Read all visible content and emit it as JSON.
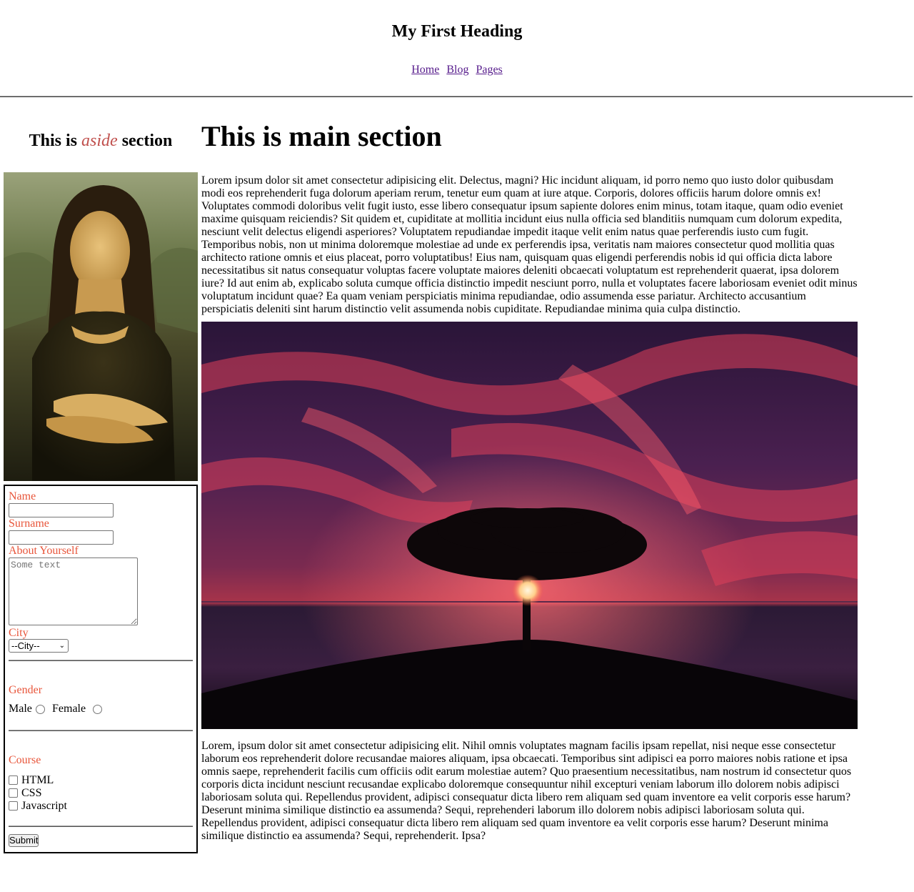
{
  "header": {
    "title": "My First Heading",
    "nav": [
      "Home",
      "Blog",
      "Pages"
    ]
  },
  "aside": {
    "title_before": "This is",
    "title_emphasis": "aside",
    "title_after": "section",
    "image": "Mona Lisa painting",
    "form": {
      "name_label": "Name",
      "name_value": "",
      "surname_label": "Surname",
      "surname_value": "",
      "about_label": "About Yourself",
      "about_placeholder": "Some text",
      "city_label": "City",
      "city_selected": "--City--",
      "gender_label": "Gender",
      "gender_options": [
        "Male",
        "Female"
      ],
      "course_label": "Course",
      "course_options": [
        "HTML",
        "CSS",
        "Javascript"
      ],
      "submit_label": "Submit"
    }
  },
  "main": {
    "title": "This is main section",
    "paragraph1": "Lorem ipsum dolor sit amet consectetur adipisicing elit. Delectus, magni? Hic incidunt aliquam, id porro nemo quo iusto dolor quibusdam modi eos reprehenderit fuga dolorum aperiam rerum, tenetur eum quam at iure atque. Corporis, dolores officiis harum dolore omnis ex! Voluptates commodi doloribus velit fugit iusto, esse libero consequatur ipsum sapiente dolores enim minus, totam itaque, quam odio eveniet maxime quisquam reiciendis? Sit quidem et, cupiditate at mollitia incidunt eius nulla officia sed blanditiis numquam cum dolorum expedita, nesciunt velit delectus eligendi asperiores? Voluptatem repudiandae impedit itaque velit enim natus quae perferendis iusto cum fugit. Temporibus nobis, non ut minima doloremque molestiae ad unde ex perferendis ipsa, veritatis nam maiores consectetur quod mollitia quas architecto ratione omnis et eius placeat, porro voluptatibus! Eius nam, quisquam quas eligendi perferendis nobis id qui officia dicta labore necessitatibus sit natus consequatur voluptas facere voluptate maiores deleniti obcaecati voluptatum est reprehenderit quaerat, ipsa dolorem iure? Id aut enim ab, explicabo soluta cumque officia distinctio impedit nesciunt porro, nulla et voluptates facere laboriosam eveniet odit minus voluptatum incidunt quae? Ea quam veniam perspiciatis minima repudiandae, odio assumenda esse pariatur. Architecto accusantium perspiciatis deleniti sint harum distinctio velit assumenda nobis cupiditate. Repudiandae minima quia culpa distinctio.",
    "image": "Tree silhouette at sunset over the sea",
    "paragraph2": "Lorem, ipsum dolor sit amet consectetur adipisicing elit. Nihil omnis voluptates magnam facilis ipsam repellat, nisi neque esse consectetur laborum eos reprehenderit dolore recusandae maiores aliquam, ipsa obcaecati. Temporibus sint adipisci ea porro maiores nobis ratione et ipsa omnis saepe, reprehenderit facilis cum officiis odit earum molestiae autem? Quo praesentium necessitatibus, nam nostrum id consectetur quos corporis dicta incidunt nesciunt recusandae explicabo doloremque consequuntur nihil excepturi veniam laborum illo dolorem nobis adipisci laboriosam soluta qui. Repellendus provident, adipisci consequatur dicta libero rem aliquam sed quam inventore ea velit corporis esse harum? Deserunt minima similique distinctio ea assumenda? Sequi, reprehenderi laborum illo dolorem nobis adipisci laboriosam soluta qui. Repellendus provident, adipisci consequatur dicta libero rem aliquam sed quam inventore ea velit corporis esse harum? Deserunt minima similique distinctio ea assumenda? Sequi, reprehenderit. Ipsa?"
  },
  "colors": {
    "label": "#e8553a",
    "aside_emphasis": "#c0504d",
    "link": "#551a8b"
  }
}
